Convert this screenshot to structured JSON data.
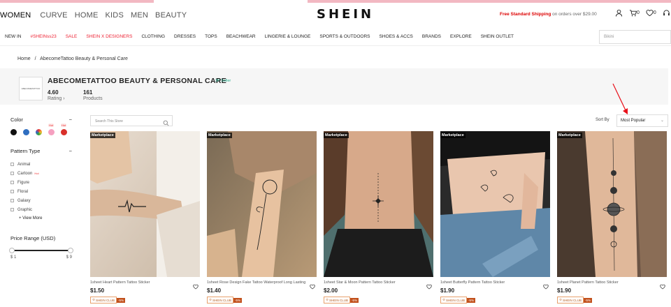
{
  "header": {
    "categories": [
      "WOMEN",
      "CURVE",
      "HOME",
      "KIDS",
      "MEN",
      "BEAUTY"
    ],
    "logo": "SHEIN",
    "shipping_bold": "Free Standard Shipping",
    "shipping_rest": " on orders over $29.00",
    "cart_count": "0",
    "wishlist_count": "0"
  },
  "nav": {
    "items": [
      "NEW IN",
      "#SHEINss23",
      "SALE",
      "SHEIN X DESIGNERS",
      "CLOTHING",
      "DRESSES",
      "TOPS",
      "BEACHWEAR",
      "LINGERIE & LOUNGE",
      "SPORTS & OUTDOORS",
      "SHOES & ACCS",
      "BRANDS",
      "EXPLORE",
      "SHEIN OUTLET"
    ],
    "search_placeholder": "Bikini"
  },
  "breadcrumb": {
    "home": "Home",
    "sep": "/",
    "current": "AbecomeTattoo Beauty & Personal Care"
  },
  "store": {
    "logo_text": "ABECOMETATTOO",
    "name": "ABECOMETATTOO BEAUTY & PERSONAL CARE",
    "seller_tag": "3P Seller",
    "rating_value": "4.60",
    "rating_label": "Rating",
    "products_value": "161",
    "products_label": "Products"
  },
  "filters": {
    "color_title": "Color",
    "colors": [
      "#111111",
      "#2f6ec0",
      "#e7a13a",
      "#f5a0c0",
      "#d9302a"
    ],
    "hot_label": "Hot",
    "pattern_title": "Pattern Type",
    "patterns": [
      "Animal",
      "Cartoon",
      "Figure",
      "Floral",
      "Galaxy",
      "Graphic"
    ],
    "view_more": "View More",
    "price_title": "Price Range (USD)",
    "price_min": "$ 1",
    "price_max": "$ 9",
    "collapse_symbol": "−"
  },
  "toolbar": {
    "search_placeholder": "Search This Store",
    "sort_label": "Sort By",
    "sort_value": "Most Popular"
  },
  "products": [
    {
      "badge": "Marketplace",
      "name": "1sheet Heart Pattern Tattoo Sticker",
      "price": "$1.50",
      "club": "SHEIN CLUB",
      "discount": "-5%"
    },
    {
      "badge": "Marketplace",
      "name": "1sheet Rose Design Fake Tattoo Waterproof Long Lasting",
      "price": "$1.40",
      "club": "SHEIN CLUB",
      "discount": "-5%"
    },
    {
      "badge": "Marketplace",
      "name": "1sheet Star & Moon Pattern Tattoo Sticker",
      "price": "$2.00",
      "club": "SHEIN CLUB",
      "discount": "-5%"
    },
    {
      "badge": "Marketplace",
      "name": "1sheet Butterfly Pattern Tattoo Sticker",
      "price": "$1.90",
      "club": "SHEIN CLUB",
      "discount": "-5%"
    },
    {
      "badge": "Marketplace",
      "name": "1sheet Planet Pattern Tattoo Sticker",
      "price": "$1.90",
      "club": "SHEIN CLUB",
      "discount": "-5%"
    }
  ]
}
